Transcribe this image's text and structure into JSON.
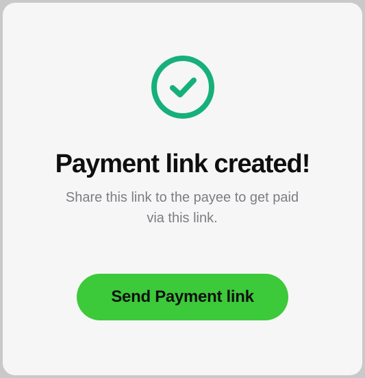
{
  "dialog": {
    "title": "Payment link created!",
    "message": "Share this link to the payee to get paid via this link.",
    "primary_action_label": "Send Payment link",
    "icon": "check-circle-icon"
  },
  "colors": {
    "success_icon": "#16b07a",
    "button_background": "#3cc93a",
    "card_background": "#f6f6f6",
    "message_text": "#7b7d83"
  }
}
